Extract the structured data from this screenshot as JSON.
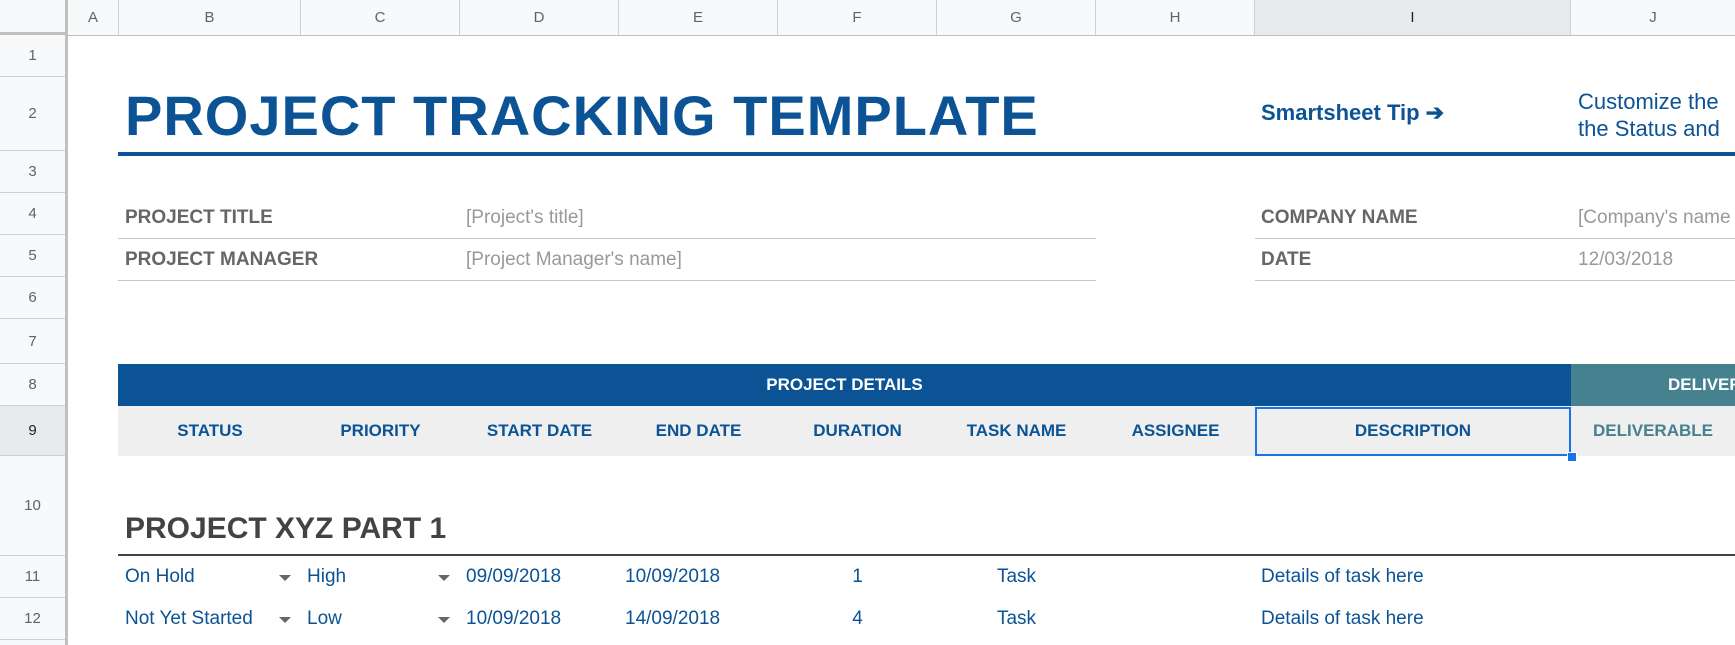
{
  "columns": [
    "A",
    "B",
    "C",
    "D",
    "E",
    "F",
    "G",
    "H",
    "I",
    "J"
  ],
  "rows": [
    "1",
    "2",
    "3",
    "4",
    "5",
    "6",
    "7",
    "8",
    "9",
    "10",
    "11",
    "12"
  ],
  "title": "PROJECT TRACKING TEMPLATE",
  "tip_label": "Smartsheet Tip ➔",
  "tip_text_line1": "Customize the",
  "tip_text_line2": "the Status and",
  "fields": {
    "project_title_label": "PROJECT TITLE",
    "project_title_value": "[Project's title]",
    "project_manager_label": "PROJECT MANAGER",
    "project_manager_value": "[Project Manager's name]",
    "company_name_label": "COMPANY NAME",
    "company_name_value": "[Company's name",
    "date_label": "DATE",
    "date_value": "12/03/2018"
  },
  "section_bar": "PROJECT DETAILS",
  "section_bar2": "DELIVER",
  "headers": [
    "STATUS",
    "PRIORITY",
    "START DATE",
    "END DATE",
    "DURATION",
    "TASK NAME",
    "ASSIGNEE",
    "DESCRIPTION",
    "DELIVERABLE"
  ],
  "section_title": "PROJECT XYZ PART 1",
  "tasks": [
    {
      "status": "On Hold",
      "priority": "High",
      "start": "09/09/2018",
      "end": "10/09/2018",
      "duration": "1",
      "name": "Task",
      "description": "Details of task here"
    },
    {
      "status": "Not Yet Started",
      "priority": "Low",
      "start": "10/09/2018",
      "end": "14/09/2018",
      "duration": "4",
      "name": "Task",
      "description": "Details of task here"
    }
  ],
  "colors": {
    "primary": "#0b5394",
    "teal": "#45818e",
    "selection": "#1a73e8"
  }
}
